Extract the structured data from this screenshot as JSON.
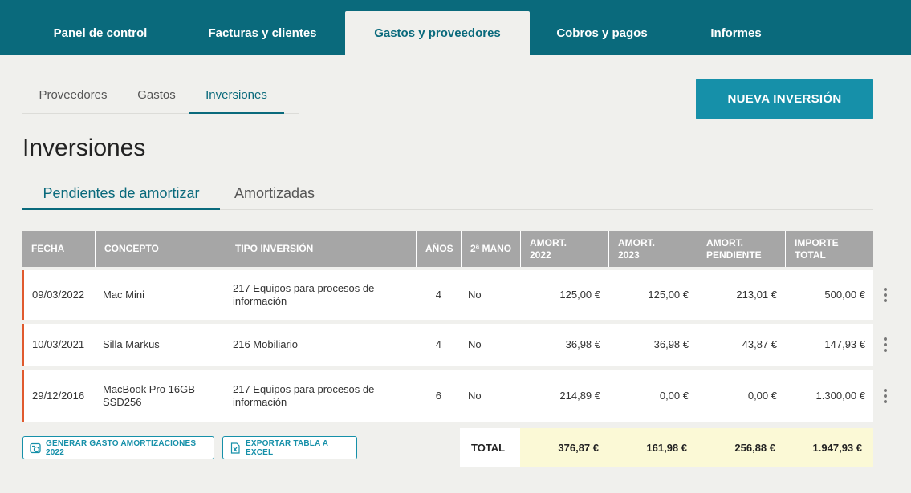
{
  "topnav": {
    "tabs": [
      "Panel de control",
      "Facturas y clientes",
      "Gastos y proveedores",
      "Cobros y pagos",
      "Informes"
    ],
    "active": 2
  },
  "subnav": {
    "items": [
      "Proveedores",
      "Gastos",
      "Inversiones"
    ],
    "active": 2
  },
  "new_button": "NUEVA INVERSIÓN",
  "page_title": "Inversiones",
  "tabs": {
    "items": [
      "Pendientes de amortizar",
      "Amortizadas"
    ],
    "active": 0
  },
  "table": {
    "headers": [
      "FECHA",
      "CONCEPTO",
      "TIPO INVERSIÓN",
      "AÑOS",
      "2ª MANO",
      "AMORT.\n2022",
      "AMORT.\n2023",
      "AMORT.\nPENDIENTE",
      "IMPORTE\nTOTAL"
    ],
    "rows": [
      [
        "09/03/2022",
        "Mac Mini",
        "217 Equipos para procesos de información",
        "4",
        "No",
        "125,00 €",
        "125,00 €",
        "213,01 €",
        "500,00 €"
      ],
      [
        "10/03/2021",
        "Silla Markus",
        "216 Mobiliario",
        "4",
        "No",
        "36,98 €",
        "36,98 €",
        "43,87 €",
        "147,93 €"
      ],
      [
        "29/12/2016",
        "MacBook Pro 16GB SSD256",
        "217 Equipos para procesos de información",
        "6",
        "No",
        "214,89 €",
        "0,00 €",
        "0,00 €",
        "1.300,00 €"
      ]
    ]
  },
  "footer": {
    "generate_button": "GENERAR GASTO AMORTIZACIONES 2022",
    "export_button": "EXPORTAR TABLA A EXCEL",
    "total_label": "TOTAL",
    "totals": [
      "376,87 €",
      "161,98 €",
      "256,88 €",
      "1.947,93 €"
    ]
  },
  "colors": {
    "primary": "#0a6a7c",
    "accent": "#1690a9",
    "row_marker": "#e05a2e",
    "total_bg": "#fbf9d6"
  },
  "icons": {
    "generate": "coins-icon",
    "export": "excel-icon",
    "row_menu": "kebab-icon"
  }
}
